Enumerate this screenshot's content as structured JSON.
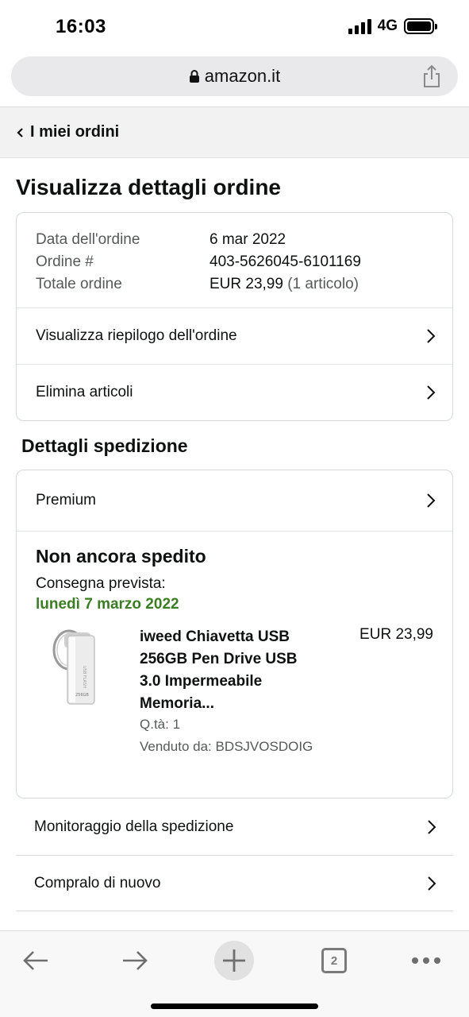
{
  "status_bar": {
    "time": "16:03",
    "network": "4G"
  },
  "browser": {
    "url": "amazon.it",
    "tab_count": "2"
  },
  "breadcrumb": {
    "label": "I miei ordini"
  },
  "page": {
    "title": "Visualizza dettagli ordine"
  },
  "order_summary": {
    "date_label": "Data dell'ordine",
    "date_value": "6 mar 2022",
    "number_label": "Ordine #",
    "number_value": "403-5626045-6101169",
    "total_label": "Totale ordine",
    "total_value": "EUR 23,99",
    "total_items": "(1 articolo)",
    "links": [
      {
        "label": "Visualizza riepilogo dell'ordine"
      },
      {
        "label": "Elimina articoli"
      }
    ]
  },
  "shipping": {
    "section_title": "Dettagli spedizione",
    "method": "Premium",
    "status": "Non ancora spedito",
    "eta_label": "Consegna prevista:",
    "eta_date": "lunedì 7 marzo 2022",
    "item": {
      "title": "iweed Chiavetta USB 256GB Pen Drive USB 3.0 Impermeabile Memoria...",
      "price": "EUR 23,99",
      "qty": "Q.tà: 1",
      "seller": "Venduto da: BDSJVOSDOIG",
      "image_text": "USB FLASH"
    },
    "actions": [
      {
        "label": "Monitoraggio della spedizione"
      },
      {
        "label": "Compralo di nuovo"
      }
    ]
  },
  "colors": {
    "accent_green": "#3b7d23",
    "text": "#0f1111",
    "muted": "#565959"
  }
}
